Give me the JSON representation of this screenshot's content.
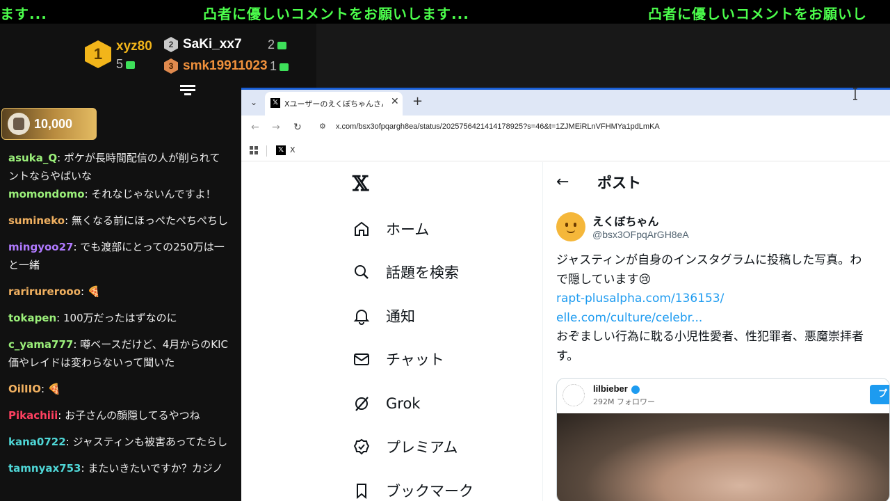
{
  "ticker": {
    "segments": [
      "ます...",
      "凸者に優しいコメントをお願いします...",
      "凸者に優しいコメントをお願いし"
    ]
  },
  "ranking": {
    "first": {
      "rank": "1",
      "name": "xyz80",
      "count": "5",
      "color": "#f2b51a"
    },
    "second": {
      "rank": "2",
      "name": "SaKi_xx7",
      "count": "2",
      "color": "#ffffff"
    },
    "third": {
      "rank": "3",
      "name": "smk19911023",
      "count": "1",
      "color": "#f0913c"
    }
  },
  "coin_badge": {
    "amount": "10,000"
  },
  "chat": [
    {
      "user": "asuka_Q",
      "color": "#9bf07a",
      "text": "ポケが長時間配信の人が削られて",
      "text2": "ントならやばいな"
    },
    {
      "user": "momondomo",
      "color": "#9bf07a",
      "text": "それなじゃないんですよ！"
    },
    {
      "user": "sumineko",
      "color": "#f0b060",
      "text": "無くなる前にほっぺたぺちぺちし"
    },
    {
      "user": "mingyoo27",
      "color": "#b07aff",
      "text": "でも渡部にとっての250万は一",
      "text2": "と一緒"
    },
    {
      "user": "rarirurerooo",
      "color": "#f0b060",
      "text": "🍕"
    },
    {
      "user": "tokapen",
      "color": "#9bf07a",
      "text": "100万だったはずなのに"
    },
    {
      "user": "c_yama777",
      "color": "#9bf07a",
      "text": "噂ベースだけど、4月からのKIC",
      "text2": "価やレイドは変わらないって聞いた"
    },
    {
      "user": "OilIIO",
      "color": "#f0b060",
      "text": "🍕"
    },
    {
      "user": "Pikachiii",
      "color": "#ff4060",
      "text": "お子さんの顔隠してるやつね"
    },
    {
      "user": "kana0722",
      "color": "#4fd6d6",
      "text": "ジャスティンも被害あってたらし"
    },
    {
      "user": "tamnyax753",
      "color": "#4fd6d6",
      "text": "またいきたいですか？カジノ"
    }
  ],
  "browser": {
    "tab_title": "Xユーザーのえくぼちゃんさん:「ジャス",
    "tab_close": "✕",
    "new_tab": "+",
    "url": "x.com/bsx3ofpqargh8ea/status/2025756421414178925?s=46&t=1ZJMEiRLnVFHMYa1pdLmKA",
    "bookmark_label": "X"
  },
  "x": {
    "logo": "𝕏",
    "nav": [
      {
        "label": "ホーム",
        "icon": "home-icon"
      },
      {
        "label": "話題を検索",
        "icon": "search-icon"
      },
      {
        "label": "通知",
        "icon": "bell-icon"
      },
      {
        "label": "チャット",
        "icon": "mail-icon"
      },
      {
        "label": "Grok",
        "icon": "grok-icon"
      },
      {
        "label": "プレミアム",
        "icon": "verified-icon"
      },
      {
        "label": "ブックマーク",
        "icon": "bookmark-icon"
      }
    ],
    "post": {
      "header": "ポスト",
      "display_name": "えくぼちゃん",
      "handle": "@bsx3OFpqArGH8eA",
      "line1": "ジャスティンが自身のインスタグラムに投稿した写真。わ",
      "line2": "で隠しています😢",
      "link1": "rapt-plusalpha.com/136153/",
      "link2": "elle.com/culture/celebr...",
      "line3": "おぞましい行為に耽る小児性愛者、性犯罪者、悪魔崇拝者",
      "line4": "す。"
    },
    "embed": {
      "user": "lilbieber",
      "followers": "292M フォロワー",
      "button": "プ"
    }
  }
}
